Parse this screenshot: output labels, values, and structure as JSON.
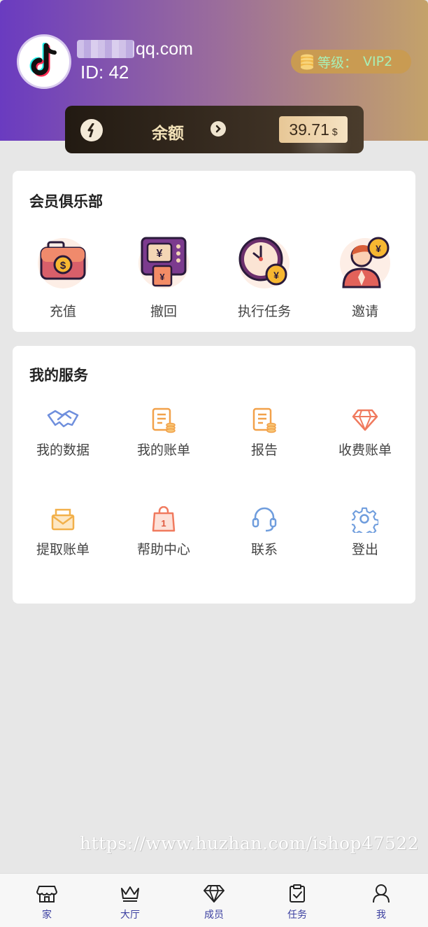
{
  "profile": {
    "email_visible": "qq.com",
    "id_text": "ID:  42",
    "level_label": "等级：",
    "level_value": "VIP2"
  },
  "balance": {
    "label": "余额",
    "amount": "39.71",
    "currency": "$"
  },
  "club": {
    "title": "会员俱乐部",
    "items": [
      {
        "label": "充值",
        "icon": "recharge-wallet-icon"
      },
      {
        "label": "撤回",
        "icon": "withdraw-atm-icon"
      },
      {
        "label": "执行任务",
        "icon": "task-clock-icon"
      },
      {
        "label": "邀请",
        "icon": "invite-person-icon"
      }
    ]
  },
  "services": {
    "title": "我的服务",
    "items": [
      {
        "label": "我的数据",
        "icon": "handshake-icon"
      },
      {
        "label": "我的账单",
        "icon": "bill-icon"
      },
      {
        "label": "报告",
        "icon": "report-icon"
      },
      {
        "label": "收费账单",
        "icon": "diamond-icon"
      },
      {
        "label": "提取账单",
        "icon": "envelope-icon"
      },
      {
        "label": "帮助中心",
        "icon": "shopping-bag-icon"
      },
      {
        "label": "联系",
        "icon": "headset-icon"
      },
      {
        "label": "登出",
        "icon": "gear-icon"
      }
    ]
  },
  "watermark": "https://www.huzhan.com/ishop47522",
  "tabbar": [
    {
      "label": "家",
      "icon": "store-icon"
    },
    {
      "label": "大厅",
      "icon": "crown-icon"
    },
    {
      "label": "成员",
      "icon": "diamond-icon"
    },
    {
      "label": "任务",
      "icon": "clipboard-icon"
    },
    {
      "label": "我",
      "icon": "user-icon"
    }
  ],
  "colors": {
    "header_start": "#6a3bc0",
    "header_end": "#c4a26a",
    "level_bg": "#c99b52",
    "level_text": "#a8f0b7",
    "tab_text": "#3b3fa0"
  }
}
